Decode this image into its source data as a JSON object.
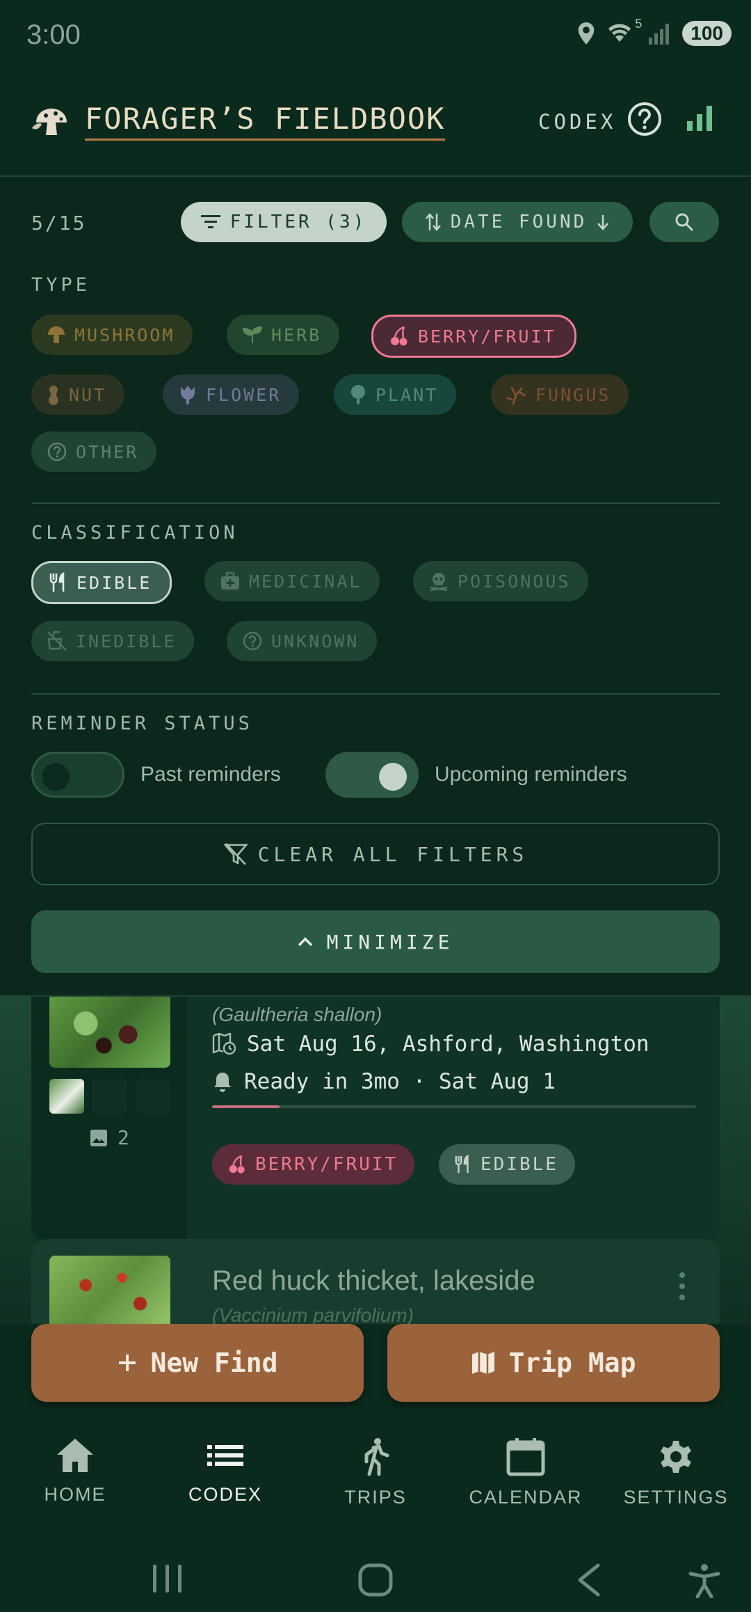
{
  "status_bar": {
    "time": "3:00",
    "wifi_badge": "5",
    "battery": "100"
  },
  "app_bar": {
    "title": "FORAGER’S FIELDBOOK",
    "view_label": "CODEX"
  },
  "toolbar": {
    "counter": "5/15",
    "filter_label": "FILTER (3)",
    "sort_label": "DATE FOUND"
  },
  "filters": {
    "type": {
      "label": "TYPE",
      "chips": [
        {
          "label": "MUSHROOM",
          "icon": "mushroom-icon",
          "selected": false,
          "color": "#a8873e"
        },
        {
          "label": "HERB",
          "icon": "sprout-icon",
          "selected": false,
          "color": "#7aa068"
        },
        {
          "label": "BERRY/FRUIT",
          "icon": "cherries-icon",
          "selected": true,
          "color": "#f07a92"
        },
        {
          "label": "NUT",
          "icon": "peanut-icon",
          "selected": false,
          "color": "#9a7a4a"
        },
        {
          "label": "FLOWER",
          "icon": "tulip-icon",
          "selected": false,
          "color": "#8e93b4"
        },
        {
          "label": "PLANT",
          "icon": "tree-icon",
          "selected": false,
          "color": "#5fa291"
        },
        {
          "label": "FUNGUS",
          "icon": "coral-icon",
          "selected": false,
          "color": "#9c6040"
        },
        {
          "label": "OTHER",
          "icon": "help-circle-icon",
          "selected": false,
          "color": "#6f8a7c"
        }
      ]
    },
    "classification": {
      "label": "CLASSIFICATION",
      "chips": [
        {
          "label": "EDIBLE",
          "icon": "utensils-icon",
          "selected": true
        },
        {
          "label": "MEDICINAL",
          "icon": "medkit-icon",
          "selected": false
        },
        {
          "label": "POISONOUS",
          "icon": "skull-icon",
          "selected": false
        },
        {
          "label": "INEDIBLE",
          "icon": "no-food-icon",
          "selected": false
        },
        {
          "label": "UNKNOWN",
          "icon": "help-circle-icon",
          "selected": false
        }
      ]
    },
    "reminder_status": {
      "label": "REMINDER STATUS",
      "past": {
        "label": "Past reminders",
        "on": false
      },
      "upcoming": {
        "label": "Upcoming reminders",
        "on": true
      }
    },
    "clear_label": "CLEAR ALL FILTERS",
    "minimize_label": "MINIMIZE"
  },
  "finds": [
    {
      "scientific_name": "(Gaultheria shallon)",
      "found": "Sat Aug 16, Ashford, Washington",
      "reminder": "Ready in 3mo · Sat Aug 1",
      "progress": 0.14,
      "photo_count": "2",
      "tags": [
        {
          "label": "BERRY/FRUIT",
          "icon": "cherries-icon"
        },
        {
          "label": "EDIBLE",
          "icon": "utensils-icon"
        }
      ]
    },
    {
      "name": "Red huck thicket, lakeside",
      "scientific_name": "(Vaccinium parvifolium)"
    }
  ],
  "actions": {
    "new_find": "New Find",
    "trip_map": "Trip Map"
  },
  "bottom_nav": [
    {
      "label": "HOME",
      "icon": "home-icon",
      "active": false
    },
    {
      "label": "CODEX",
      "icon": "list-icon",
      "active": true
    },
    {
      "label": "TRIPS",
      "icon": "hiker-icon",
      "active": false
    },
    {
      "label": "CALENDAR",
      "icon": "calendar-icon",
      "active": false
    },
    {
      "label": "SETTINGS",
      "icon": "gear-icon",
      "active": false
    }
  ],
  "colors": {
    "background": "#0b2a1e",
    "accent_brown": "#9a633b",
    "berry_pink": "#f07a92",
    "panel_green": "#2a5a44"
  }
}
